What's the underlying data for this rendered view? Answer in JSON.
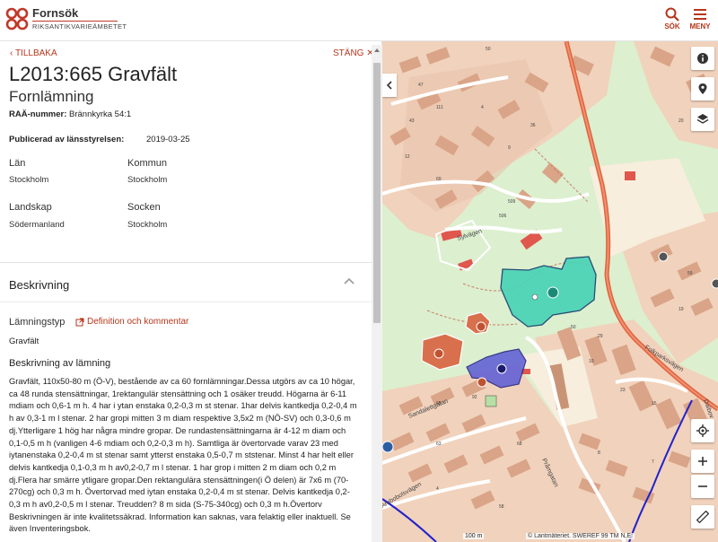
{
  "header": {
    "logo_name": "Fornsök",
    "logo_sub": "RIKSANTIKVARIEÄMBETET",
    "search_label": "SÖK",
    "menu_label": "MENY"
  },
  "panel": {
    "back_label": "TILLBAKA",
    "close_label": "STÄNG",
    "title": "L2013:665 Gravfält",
    "subtitle": "Fornlämning",
    "raa_label": "RAÄ-nummer:",
    "raa_value": "Brännkyrka 54:1",
    "published_label": "Publicerad av länsstyrelsen:",
    "published_value": "2019-03-25",
    "fields": [
      {
        "label": "Län",
        "value": "Stockholm"
      },
      {
        "label": "Kommun",
        "value": "Stockholm"
      },
      {
        "label": "Landskap",
        "value": "Södermanland"
      },
      {
        "label": "Socken",
        "value": "Stockholm"
      }
    ],
    "section_title": "Beskrivning",
    "lamningstyp_label": "Lämningstyp",
    "definition_link": "Definition och kommentar",
    "lamningstyp_value": "Gravfält",
    "description_heading": "Beskrivning av lämning",
    "description_text": "Gravfält, 110x50-80 m (Ö-V), bestående av ca 60 fornlämningar.Dessa utgörs av ca 10 högar, ca 48 runda stensättningar, 1rektangulär stensättning och 1 osäker treudd. Högarna är 6-11 mdiam och 0,6-1 m h. 4 har i ytan enstaka 0,2-0,3 m st stenar. 1har delvis kantkedja 0,2-0,4 m h av 0,3-1 m l stenar. 2 har gropi mitten 3 m diam respektive 3,5x2 m (NÖ-SV) och 0,3-0,6 m dj.Ytterligare 1 hög har några mindre gropar. De rundastensättningarna är 4-12 m diam och 0,1-0,5 m h (vanligen 4-6 mdiam och 0,2-0,3 m h). Samtliga är övertorvade varav 23 med iytanenstaka 0,2-0,4 m st stenar samt ytterst enstaka 0,5-0,7 m ststenar. Minst 4 har helt eller delvis kantkedja 0,1-0,3 m h av0,2-0,7 m l stenar. 1 har grop i mitten 2 m diam och 0,2 m dj.Flera har smärre ytligare gropar.Den rektangulära stensättningen(i Ö delen) är 7x6 m (70-270cg) och 0,3 m h. Övertorvad med iytan enstaka 0,2-0,4 m st stenar. Delvis kantkedja 0,2-0,3 m h av0,2-0,5 m l stenar. Treudden? 8 m sida (S-75-340cg) och 0,3 m h.Övertorv Beskrivningen är inte kvalitetssäkrad. Information kan saknas, vara felaktig eller inaktuell. Se även Inventeringsbok."
  },
  "map": {
    "scale_label": "100 m",
    "attribution": "© Lantmäteriet. SWEREF 99 TM N,E:",
    "streets": [
      "Sylvägen",
      "Sandalettgatan",
      "Folkparksvägen",
      "Pråmgatan",
      "Arnbobolsvägen",
      "Dalbov"
    ],
    "numbers": [
      "50",
      "47",
      "43",
      "12",
      "69",
      "4",
      "9",
      "36",
      "509",
      "506",
      "20",
      "59",
      "19",
      "50",
      "29",
      "10",
      "23",
      "15",
      "65",
      "92",
      "63",
      "68",
      "8",
      "7",
      "4",
      "58",
      "111"
    ],
    "colors": {
      "residential": "#f1d2bc",
      "building": "#d9a487",
      "green": "#dcefcf",
      "road_major": "#e0643c",
      "fornlamning": "#47d3b6",
      "fornlamning_blue": "#5b5bd6",
      "water_line": "#2222cc"
    }
  },
  "colors": {
    "accent": "#b6361b"
  }
}
